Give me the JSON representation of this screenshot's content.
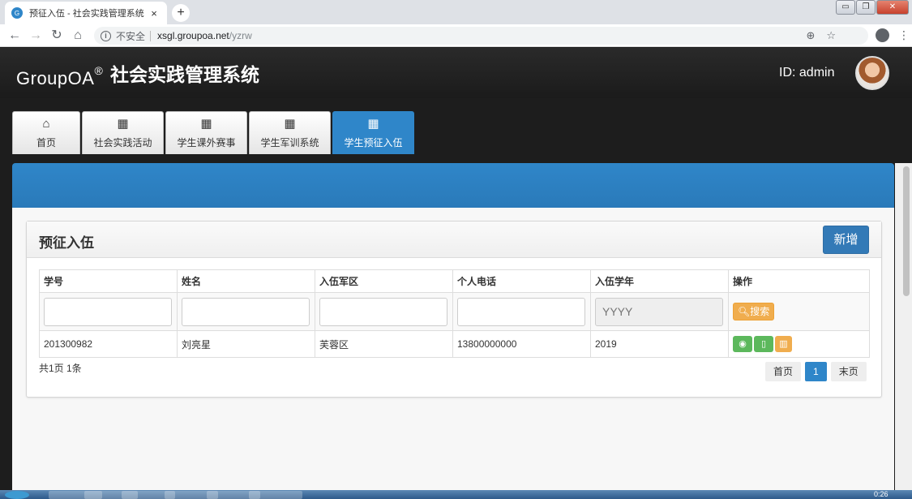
{
  "browser": {
    "tab_title": "预征入伍 - 社会实践管理系统",
    "tab_close": "×",
    "new_tab": "+",
    "favicon": "G",
    "security_label": "不安全",
    "host": "xsgl.groupoa.net",
    "path": "/yzrw",
    "window_controls": [
      "▭",
      "❐",
      "✕"
    ]
  },
  "header": {
    "logo": "GroupOA",
    "logo_mark": "®",
    "system_title": "社会实践管理系统",
    "user_id": "ID: admin"
  },
  "module_tabs": [
    {
      "icon": "home-icon",
      "glyph": "⌂",
      "label": "首页"
    },
    {
      "icon": "table-icon",
      "glyph": "▦",
      "label": "社会实践活动"
    },
    {
      "icon": "table-icon",
      "glyph": "▦",
      "label": "学生课外赛事"
    },
    {
      "icon": "table-icon",
      "glyph": "▦",
      "label": "学生军训系统"
    },
    {
      "icon": "table-icon",
      "glyph": "▦",
      "label": "学生预征入伍"
    }
  ],
  "panel": {
    "title": "预征入伍",
    "add_label": "新增"
  },
  "table": {
    "columns": [
      "学号",
      "姓名",
      "入伍军区",
      "个人电话",
      "入伍学年",
      "操作"
    ],
    "year_placeholder": "YYYY",
    "search_label": "搜索",
    "rows": [
      {
        "student_id": "201300982",
        "name": "刘亮星",
        "district": "芙蓉区",
        "phone": "13800000000",
        "year": "2019"
      }
    ]
  },
  "summary": "共1页 1条",
  "pager": {
    "first": "首页",
    "current": "1",
    "last": "末页"
  },
  "taskbar": {
    "clock": "0:26"
  },
  "colors": {
    "primary": "#2f86c9",
    "warning": "#f0ad4e",
    "success": "#5cb85c",
    "header_bg": "#1d1d1d"
  }
}
